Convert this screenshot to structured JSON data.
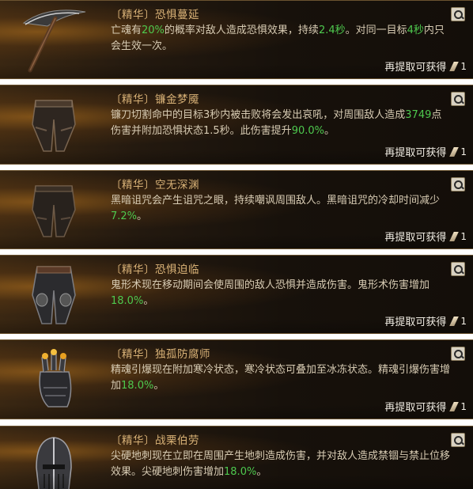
{
  "cards": [
    {
      "title": "〔精华〕恐惧蔓延",
      "desc": [
        {
          "t": "亡魂有"
        },
        {
          "t": "20%",
          "hl": true
        },
        {
          "t": "的概率对敌人造成恐惧效果，持续"
        },
        {
          "t": "2.4秒",
          "hl": true
        },
        {
          "t": "。对同一目标"
        },
        {
          "t": "4秒",
          "hl": true
        },
        {
          "t": "内只会生效一次。"
        }
      ],
      "footer_label": "再提取可获得",
      "count": "1",
      "icon": "scythe-icon"
    },
    {
      "title": "〔精华〕镰金梦魇",
      "desc": [
        {
          "t": "镰刀切割命中的目标3秒内被击败将会发出哀吼，对周围敌人造成"
        },
        {
          "t": "3749",
          "hl": true
        },
        {
          "t": "点伤害并附加恐惧状态1.5秒。此伤害提升"
        },
        {
          "t": "90.0%",
          "hl": true
        },
        {
          "t": "。"
        }
      ],
      "footer_label": "再提取可获得",
      "count": "1",
      "icon": "pants-icon"
    },
    {
      "title": "〔精华〕空无深渊",
      "desc": [
        {
          "t": "黑暗诅咒会产生诅咒之眼，持续嘲讽周围敌人。黑暗诅咒的冷却时间减少"
        },
        {
          "t": "7.2%",
          "hl": true
        },
        {
          "t": "。"
        }
      ],
      "footer_label": "再提取可获得",
      "count": "1",
      "icon": "pants-icon"
    },
    {
      "title": "〔精华〕恐惧迫临",
      "desc": [
        {
          "t": "鬼形术现在移动期间会使周围的敌人恐惧并造成伤害。鬼形术伤害增加"
        },
        {
          "t": "18.0%",
          "hl": true
        },
        {
          "t": "。"
        }
      ],
      "footer_label": "再提取可获得",
      "count": "1",
      "icon": "armored-pants-icon"
    },
    {
      "title": "〔精华〕独孤防腐师",
      "desc": [
        {
          "t": "精魂引爆现在附加寒冷状态，寒冷状态可叠加至冰冻状态。精魂引爆伤害增加"
        },
        {
          "t": "18.0%",
          "hl": true
        },
        {
          "t": "。"
        }
      ],
      "footer_label": "再提取可获得",
      "count": "1",
      "icon": "gauntlet-icon"
    },
    {
      "title": "〔精华〕战栗伯劳",
      "desc": [
        {
          "t": "尖硬地刺现在立即在周围产生地刺造成伤害，并对敌人造成禁锢与禁止位移效果。尖硬地刺伤害增加"
        },
        {
          "t": "18.0%",
          "hl": true
        },
        {
          "t": "。"
        }
      ],
      "footer_label": "",
      "count": "",
      "icon": "helmet-icon"
    }
  ]
}
